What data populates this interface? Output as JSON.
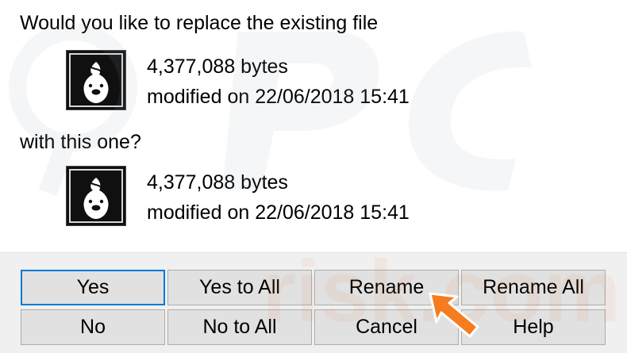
{
  "dialog": {
    "question_existing": "Would you like to replace the existing file",
    "question_new": "with this one?",
    "existing_file": {
      "size": "4,377,088 bytes",
      "modified": "modified on 22/06/2018 15:41"
    },
    "new_file": {
      "size": "4,377,088 bytes",
      "modified": "modified on 22/06/2018 15:41"
    }
  },
  "buttons": {
    "yes": "Yes",
    "yes_to_all": "Yes to All",
    "rename": "Rename",
    "rename_all": "Rename All",
    "no": "No",
    "no_to_all": "No to All",
    "cancel": "Cancel",
    "help": "Help"
  },
  "colors": {
    "default_button_border": "#0078d7",
    "button_face": "#e1e1e1",
    "arrow": "#f57c1f"
  },
  "icons": [
    "file-thumbnail-icon",
    "pointer-arrow-icon"
  ]
}
